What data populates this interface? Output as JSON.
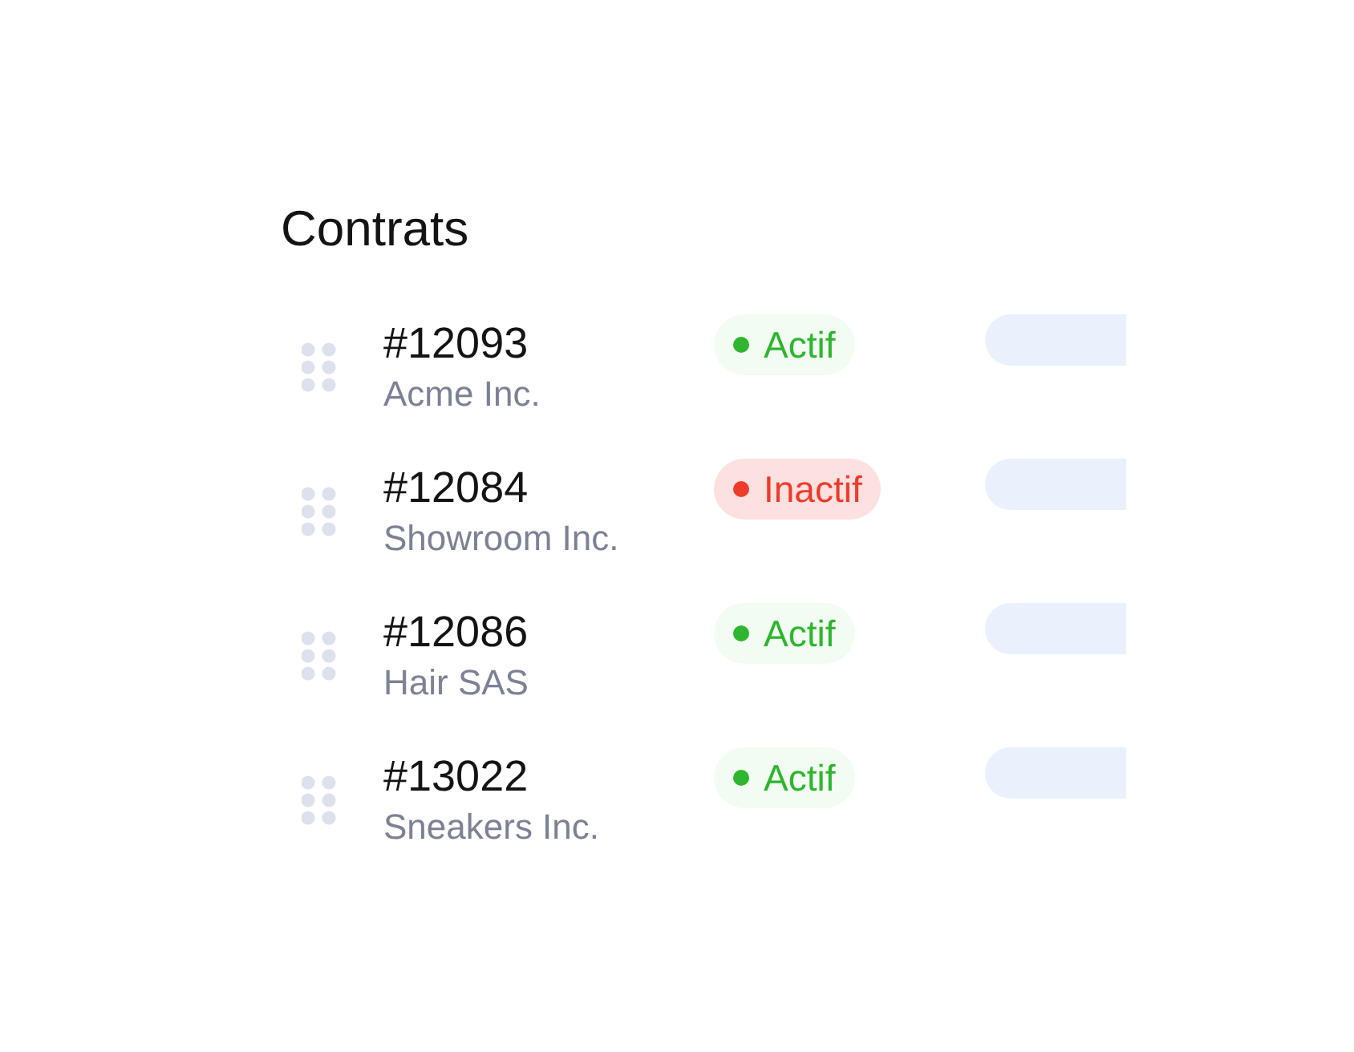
{
  "title": "Contrats",
  "contracts": [
    {
      "number": "#12093",
      "company": "Acme Inc.",
      "status": {
        "kind": "active",
        "label": "Actif"
      }
    },
    {
      "number": "#12084",
      "company": "Showroom Inc.",
      "status": {
        "kind": "inactive",
        "label": "Inactif"
      }
    },
    {
      "number": "#12086",
      "company": "Hair SAS",
      "status": {
        "kind": "active",
        "label": "Actif"
      }
    },
    {
      "number": "#13022",
      "company": "Sneakers Inc.",
      "status": {
        "kind": "active",
        "label": "Actif"
      }
    }
  ]
}
